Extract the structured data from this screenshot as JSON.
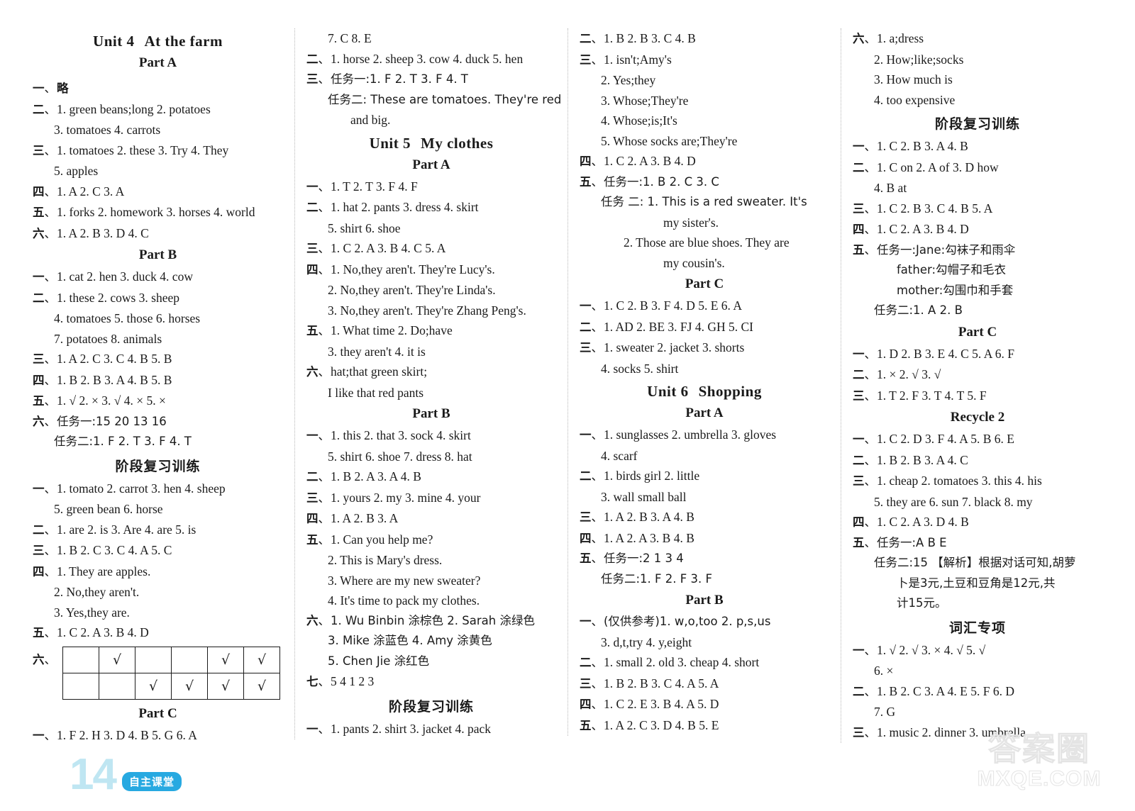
{
  "page": {
    "number": "14",
    "brand": "自主课堂",
    "watermark_cn": "答案圈",
    "watermark_en": "MXQE.COM"
  },
  "col1": {
    "unit_title_a": "Unit 4",
    "unit_title_b": "At the farm",
    "partA": "Part A",
    "partB": "Part B",
    "partC": "Part C",
    "review": "阶段复习训练",
    "a": [
      {
        "n": "一",
        "t": "略"
      },
      {
        "n": "二",
        "t": "1. green beans;long   2. potatoes"
      },
      {
        "n": "",
        "t": "3. tomatoes   4. carrots",
        "indent": 1
      },
      {
        "n": "三",
        "t": "1. tomatoes   2. these   3. Try   4. They"
      },
      {
        "n": "",
        "t": "5. apples",
        "indent": 1
      },
      {
        "n": "四",
        "t": "1. A   2. C   3. A"
      },
      {
        "n": "五",
        "t": "1. forks   2. homework   3. horses   4. world"
      },
      {
        "n": "六",
        "t": "1. A   2. B   3. D   4. C"
      }
    ],
    "b": [
      {
        "n": "一",
        "t": "1. cat   2. hen   3. duck   4. cow"
      },
      {
        "n": "二",
        "t": "1. these   2. cows   3. sheep"
      },
      {
        "n": "",
        "t": "4. tomatoes   5. those   6. horses",
        "indent": 1
      },
      {
        "n": "",
        "t": "7. potatoes   8. animals",
        "indent": 1
      },
      {
        "n": "三",
        "t": "1. A   2. C   3. C   4. B   5. B"
      },
      {
        "n": "四",
        "t": "1. B   2. B   3. A   4. B   5. B"
      },
      {
        "n": "五",
        "t": "1. √   2. ×   3. √   4. ×   5. ×"
      },
      {
        "n": "六",
        "t": "任务一:15   20   13   16"
      },
      {
        "n": "",
        "t": "任务二:1. F   2. T   3. F   4. T",
        "indent": 1
      }
    ],
    "review_items": [
      {
        "n": "一",
        "t": "1. tomato   2. carrot   3. hen   4. sheep"
      },
      {
        "n": "",
        "t": "5. green bean   6. horse",
        "indent": 1
      },
      {
        "n": "二",
        "t": "1. are   2. is   3. Are   4. are   5. is"
      },
      {
        "n": "三",
        "t": "1. B   2. C   3. C   4. A   5. C"
      },
      {
        "n": "四",
        "t": "1. They are apples."
      },
      {
        "n": "",
        "t": "2. No,they aren't.",
        "indent": 1
      },
      {
        "n": "",
        "t": "3. Yes,they are.",
        "indent": 1
      },
      {
        "n": "五",
        "t": "1. C   2. A   3. B   4. D"
      }
    ],
    "grid_label": "六",
    "grid_rows": [
      [
        "",
        "√",
        "",
        "",
        "√",
        "√"
      ],
      [
        "",
        "",
        "√",
        "√",
        "√",
        "√"
      ]
    ],
    "c": [
      {
        "n": "一",
        "t": "1. F   2. H   3. D   4. B   5. G   6. A"
      }
    ]
  },
  "col2": {
    "unit_title_a": "Unit 5",
    "unit_title_b": "My clothes",
    "partA": "Part A",
    "partB": "Part B",
    "review": "阶段复习训练",
    "cont": [
      {
        "n": "",
        "t": "7. C   8. E",
        "indent": 1
      },
      {
        "n": "二",
        "t": "1. horse   2. sheep   3. cow   4. duck   5. hen"
      },
      {
        "n": "三",
        "t": "任务一:1. F   2. T   3. F   4. T"
      },
      {
        "n": "",
        "t": "任务二: These are tomatoes. They're red",
        "indent": 1
      },
      {
        "n": "",
        "t": "and big.",
        "indent": 2
      }
    ],
    "a": [
      {
        "n": "一",
        "t": "1. T   2. T   3. F   4. F"
      },
      {
        "n": "二",
        "t": "1. hat   2. pants   3. dress   4. skirt"
      },
      {
        "n": "",
        "t": "5. shirt   6. shoe",
        "indent": 1
      },
      {
        "n": "三",
        "t": "1. C   2. A   3. B   4. C   5. A"
      },
      {
        "n": "四",
        "t": "1. No,they aren't. They're Lucy's."
      },
      {
        "n": "",
        "t": "2. No,they aren't. They're Linda's.",
        "indent": 1
      },
      {
        "n": "",
        "t": "3. No,they aren't. They're Zhang Peng's.",
        "indent": 1
      },
      {
        "n": "五",
        "t": "1. What time   2. Do;have"
      },
      {
        "n": "",
        "t": "3. they aren't   4. it is",
        "indent": 1
      },
      {
        "n": "六",
        "t": "hat;that green skirt;"
      },
      {
        "n": "",
        "t": "I like that red pants",
        "indent": 1
      }
    ],
    "b": [
      {
        "n": "一",
        "t": "1. this   2. that   3. sock   4. skirt"
      },
      {
        "n": "",
        "t": "5. shirt   6. shoe   7. dress   8. hat",
        "indent": 1
      },
      {
        "n": "二",
        "t": "1. B   2. A   3. A   4. B"
      },
      {
        "n": "三",
        "t": "1. yours   2. my   3. mine   4. your"
      },
      {
        "n": "四",
        "t": "1. A   2. B   3. A"
      },
      {
        "n": "五",
        "t": "1. Can you help me?"
      },
      {
        "n": "",
        "t": "2. This is Mary's dress.",
        "indent": 1
      },
      {
        "n": "",
        "t": "3. Where are my new sweater?",
        "indent": 1
      },
      {
        "n": "",
        "t": "4. It's time to pack my clothes.",
        "indent": 1
      },
      {
        "n": "六",
        "t": "1. Wu Binbin 涂棕色   2. Sarah 涂绿色"
      },
      {
        "n": "",
        "t": "3. Mike 涂蓝色   4. Amy 涂黄色",
        "indent": 1
      },
      {
        "n": "",
        "t": "5. Chen Jie 涂红色",
        "indent": 1
      },
      {
        "n": "七",
        "t": "5 4 1 2 3"
      }
    ],
    "review_items": [
      {
        "n": "一",
        "t": "1. pants   2. shirt   3. jacket   4. pack"
      }
    ]
  },
  "col3": {
    "unit_title_a": "Unit 6",
    "unit_title_b": "Shopping",
    "partA": "Part A",
    "partB": "Part B",
    "partC": "Part C",
    "cont": [
      {
        "n": "二",
        "t": "1. B   2. B   3. C   4. B"
      },
      {
        "n": "三",
        "t": "1. isn't;Amy's"
      },
      {
        "n": "",
        "t": "2. Yes;they",
        "indent": 1
      },
      {
        "n": "",
        "t": "3. Whose;They're",
        "indent": 1
      },
      {
        "n": "",
        "t": "4. Whose;is;It's",
        "indent": 1
      },
      {
        "n": "",
        "t": "5. Whose socks are;They're",
        "indent": 1
      },
      {
        "n": "四",
        "t": "1. C   2. A   3. B   4. D"
      },
      {
        "n": "五",
        "t": "任务一:1. B   2. C   3. C"
      },
      {
        "n": "",
        "t": "任务 二: 1. This is a red sweater. It's",
        "indent": 1
      },
      {
        "n": "",
        "t": "my sister's.",
        "indent": 3
      },
      {
        "n": "",
        "t": "2. Those are blue shoes. They are",
        "indent": 2
      },
      {
        "n": "",
        "t": "my cousin's.",
        "indent": 3
      }
    ],
    "c_prev": [
      {
        "n": "一",
        "t": "1. C   2. B   3. F   4. D   5. E   6. A"
      },
      {
        "n": "二",
        "t": "1. AD   2. BE   3. FJ   4. GH   5. CI"
      },
      {
        "n": "三",
        "t": "1. sweater   2. jacket   3. shorts"
      },
      {
        "n": "",
        "t": "4. socks   5. shirt",
        "indent": 1
      }
    ],
    "a": [
      {
        "n": "一",
        "t": "1. sunglasses   2. umbrella   3. gloves"
      },
      {
        "n": "",
        "t": "4. scarf",
        "indent": 1
      },
      {
        "n": "二",
        "t": "1. birds   girl   2. little"
      },
      {
        "n": "",
        "t": "3. wall   small   ball",
        "indent": 1
      },
      {
        "n": "三",
        "t": "1. A   2. B   3. A   4. B"
      },
      {
        "n": "四",
        "t": "1. A   2. A   3. B   4. B"
      },
      {
        "n": "五",
        "t": "任务一:2   1   3   4"
      },
      {
        "n": "",
        "t": "任务二:1. F   2. F   3. F",
        "indent": 1
      }
    ],
    "b": [
      {
        "n": "一",
        "t": "(仅供参考)1. w,o,too   2. p,s,us"
      },
      {
        "n": "",
        "t": "3. d,t,try   4. y,eight",
        "indent": 1
      },
      {
        "n": "二",
        "t": "1. small   2. old   3. cheap   4. short"
      },
      {
        "n": "三",
        "t": "1. B   2. B   3. C   4. A   5. A"
      },
      {
        "n": "四",
        "t": "1. C   2. E   3. B   4. A   5. D"
      },
      {
        "n": "五",
        "t": "1. A   2. C   3. D   4. B   5. E"
      }
    ]
  },
  "col4": {
    "review": "阶段复习训练",
    "partC": "Part C",
    "recycle": "Recycle 2",
    "vocab": "词汇专项",
    "cont": [
      {
        "n": "六",
        "t": "1. a;dress"
      },
      {
        "n": "",
        "t": "2. How;like;socks",
        "indent": 1
      },
      {
        "n": "",
        "t": "3. How much is",
        "indent": 1
      },
      {
        "n": "",
        "t": "4. too expensive",
        "indent": 1
      }
    ],
    "review_items": [
      {
        "n": "一",
        "t": "1. C   2. B   3. A   4. B"
      },
      {
        "n": "二",
        "t": "1. C   on   2. A   of   3. D   how"
      },
      {
        "n": "",
        "t": "4. B   at",
        "indent": 1
      },
      {
        "n": "三",
        "t": "1. C   2. B   3. C   4. B   5. A"
      },
      {
        "n": "四",
        "t": "1. C   2. A   3. B   4. D"
      },
      {
        "n": "五",
        "t": "任务一:Jane:勾袜子和雨伞"
      },
      {
        "n": "",
        "t": "father:勾帽子和毛衣",
        "indent": 3
      },
      {
        "n": "",
        "t": "mother:勾围巾和手套",
        "indent": 3
      },
      {
        "n": "",
        "t": "任务二:1. A   2. B",
        "indent": 1
      }
    ],
    "c": [
      {
        "n": "一",
        "t": "1. D   2. B   3. E   4. C   5. A   6. F"
      },
      {
        "n": "二",
        "t": "1. ×   2. √   3. √"
      },
      {
        "n": "三",
        "t": "1. T   2. F   3. T   4. T   5. F"
      }
    ],
    "recycle_items": [
      {
        "n": "一",
        "t": "1. C   2. D   3. F   4. A   5. B   6. E"
      },
      {
        "n": "二",
        "t": "1. B   2. B   3. A   4. C"
      },
      {
        "n": "三",
        "t": "1. cheap   2. tomatoes   3. this   4. his"
      },
      {
        "n": "",
        "t": "5. they are   6. sun   7. black   8. my",
        "indent": 1
      },
      {
        "n": "四",
        "t": "1. C   2. A   3. D   4. B"
      },
      {
        "n": "五",
        "t": "任务一:A B E"
      },
      {
        "n": "",
        "t": "任务二:15  【解析】根据对话可知,胡萝",
        "indent": 1
      },
      {
        "n": "",
        "t": "卜是3元,土豆和豆角是12元,共",
        "indent": 3
      },
      {
        "n": "",
        "t": "计15元。",
        "indent": 3
      }
    ],
    "vocab_items": [
      {
        "n": "一",
        "t": "1. √   2. √   3. ×   4. √   5. √"
      },
      {
        "n": "",
        "t": "6. ×",
        "indent": 1
      },
      {
        "n": "二",
        "t": "1. B   2. C   3. A   4. E   5. F   6. D"
      },
      {
        "n": "",
        "t": "7. G",
        "indent": 1
      },
      {
        "n": "三",
        "t": "1. music   2. dinner   3. umbrella"
      }
    ]
  }
}
